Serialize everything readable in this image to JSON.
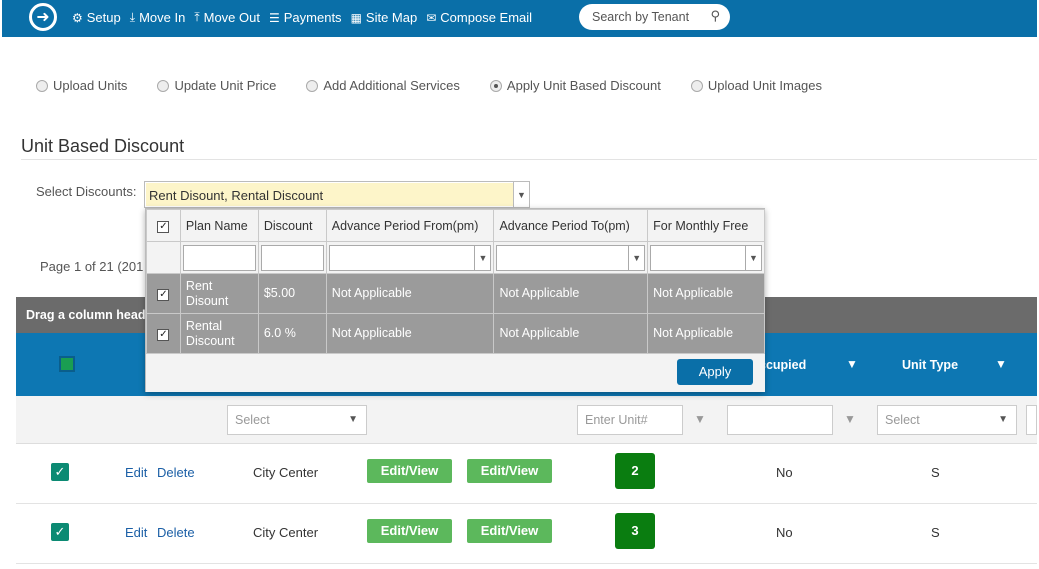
{
  "nav": {
    "items": [
      {
        "label": "Setup",
        "icon": "gear-icon"
      },
      {
        "label": "Move In",
        "icon": "move-in-icon"
      },
      {
        "label": "Move Out",
        "icon": "move-out-icon"
      },
      {
        "label": "Payments",
        "icon": "coins-icon"
      },
      {
        "label": "Site Map",
        "icon": "grid-icon"
      },
      {
        "label": "Compose Email",
        "icon": "envelope-icon"
      }
    ],
    "search_placeholder": "Search by Tenant"
  },
  "options": {
    "items": [
      {
        "label": "Upload Units",
        "selected": false
      },
      {
        "label": "Update Unit Price",
        "selected": false
      },
      {
        "label": "Add Additional Services",
        "selected": false
      },
      {
        "label": "Apply Unit Based Discount",
        "selected": true
      },
      {
        "label": "Upload Unit Images",
        "selected": false
      }
    ]
  },
  "section": {
    "title": "Unit Based Discount"
  },
  "discount_select": {
    "label": "Select Discounts:",
    "value": "Rent Disount, Rental Discount"
  },
  "pager": {
    "text": "Page 1 of 21 (201"
  },
  "grid": {
    "drag_text": "Drag a column heade",
    "headers": {
      "occupied": "ccupied",
      "unit_type": "Unit Type"
    },
    "filters": {
      "select1": "Select",
      "unit_placeholder": "Enter Unit#",
      "select2": "Select"
    },
    "rows": [
      {
        "edit": "Edit",
        "delete": "Delete",
        "location": "City Center",
        "btn1": "Edit/View",
        "btn2": "Edit/View",
        "unit": "2",
        "occupied": "No",
        "type": "S"
      },
      {
        "edit": "Edit",
        "delete": "Delete",
        "location": "City Center",
        "btn1": "Edit/View",
        "btn2": "Edit/View",
        "unit": "3",
        "occupied": "No",
        "type": "S"
      }
    ]
  },
  "popup": {
    "columns": [
      "Plan Name",
      "Discount",
      "Advance Period From(pm)",
      "Advance Period To(pm)",
      "For Monthly Free"
    ],
    "rows": [
      {
        "plan": "Rent Disount",
        "discount": "$5.00",
        "from": "Not Applicable",
        "to": "Not Applicable",
        "free": "Not Applicable"
      },
      {
        "plan": "Rental Discount",
        "discount": "6.0 %",
        "from": "Not Applicable",
        "to": "Not Applicable",
        "free": "Not Applicable"
      }
    ],
    "apply_label": "Apply"
  },
  "colors": {
    "topbar": "#0a6fa8",
    "grid_header": "#0d77b3",
    "green_button": "#5cb85c",
    "unit_badge": "#0a7d10"
  }
}
